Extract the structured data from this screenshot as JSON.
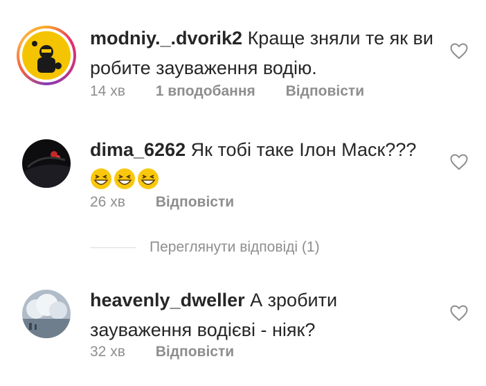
{
  "comments": [
    {
      "username": "modniy._.dvorik2",
      "text": "Краще зняли те як ви робите зауваження водію.",
      "time": "14 хв",
      "likes": "1 вподобання",
      "reply": "Відповісти",
      "has_story": true,
      "avatar_colors": {
        "bg": "#f5c400",
        "figure": "#1a1a1a"
      }
    },
    {
      "username": "dima_6262",
      "text": "Як тобі таке Ілон Маск???",
      "emoji": [
        "grinning-squinting-face-emoji",
        "grinning-squinting-face-emoji",
        "grinning-squinting-face-emoji"
      ],
      "time": "26 хв",
      "reply": "Відповісти",
      "has_story": false
    },
    {
      "username": "heavenly_dweller",
      "text": "А зробити зауваження водієві - ніяк?",
      "time": "32 хв",
      "reply": "Відповісти",
      "has_story": false
    }
  ],
  "view_replies": "Переглянути відповіді (1)",
  "colors": {
    "text": "#262626",
    "muted": "#8e8e8e",
    "heart": "#8e8e8e",
    "divider": "#dbdbdb"
  }
}
